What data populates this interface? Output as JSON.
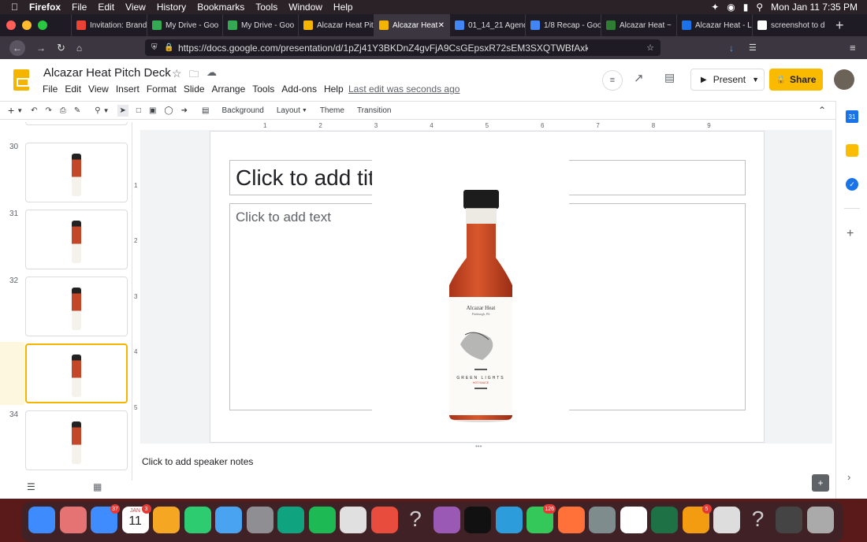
{
  "menubar": {
    "apple": "",
    "app": "Firefox",
    "items": [
      "File",
      "Edit",
      "View",
      "History",
      "Bookmarks",
      "Tools",
      "Window",
      "Help"
    ],
    "clock": "Mon Jan 11  7:35 PM"
  },
  "tabs": [
    {
      "label": "Invitation: Brand",
      "color": "#ea4335"
    },
    {
      "label": "My Drive - Goo",
      "color": "#34a853"
    },
    {
      "label": "My Drive - Goo",
      "color": "#34a853"
    },
    {
      "label": "Alcazar Heat Pit",
      "color": "#f4b400"
    },
    {
      "label": "Alcazar Heat",
      "color": "#f4b400",
      "active": true
    },
    {
      "label": "01_14_21 Agend",
      "color": "#4285f4"
    },
    {
      "label": "1/8 Recap - Goo",
      "color": "#4285f4"
    },
    {
      "label": "Alcazar Heat ~",
      "color": "#2e7d32"
    },
    {
      "label": "Alcazar Heat - L",
      "color": "#1a73e8"
    },
    {
      "label": "screenshot to d",
      "color": "#ffffff"
    }
  ],
  "url": "https://docs.google.com/presentation/d/1pZj41Y3BKDnZ4gvFjA9CsGEpsxR72sEM3SXQTWBfAxk/edit#sli",
  "doc": {
    "title": "Alcazar Heat Pitch Deck",
    "menu": [
      "File",
      "Edit",
      "View",
      "Insert",
      "Format",
      "Slide",
      "Arrange",
      "Tools",
      "Add-ons",
      "Help"
    ],
    "last_edit": "Last edit was seconds ago",
    "present": "Present",
    "share": "Share"
  },
  "toolbar": {
    "background": "Background",
    "layout": "Layout",
    "theme": "Theme",
    "transition": "Transition"
  },
  "slides": [
    {
      "num": "30"
    },
    {
      "num": "31"
    },
    {
      "num": "32"
    },
    {
      "num": "33"
    },
    {
      "num": "34"
    }
  ],
  "ruler": [
    "1",
    "2",
    "3",
    "4",
    "5",
    "6",
    "7",
    "8",
    "9"
  ],
  "ruler_v": [
    "1",
    "2",
    "3",
    "4",
    "5"
  ],
  "slide": {
    "title_placeholder": "Click to add title",
    "body_placeholder": "Click to add text",
    "label_brand": "Alcazar Heat",
    "label_city": "Pittsburgh, PA",
    "label_product": "GREEN LIGHTS",
    "label_sub": "HOT SAUCE"
  },
  "notes": "Click to add speaker notes",
  "dock_badges": {
    "mail": "37",
    "calendar_day": "11",
    "calendar_month": "JAN",
    "calendar_badge": "3",
    "messages": "126",
    "store": "5"
  }
}
